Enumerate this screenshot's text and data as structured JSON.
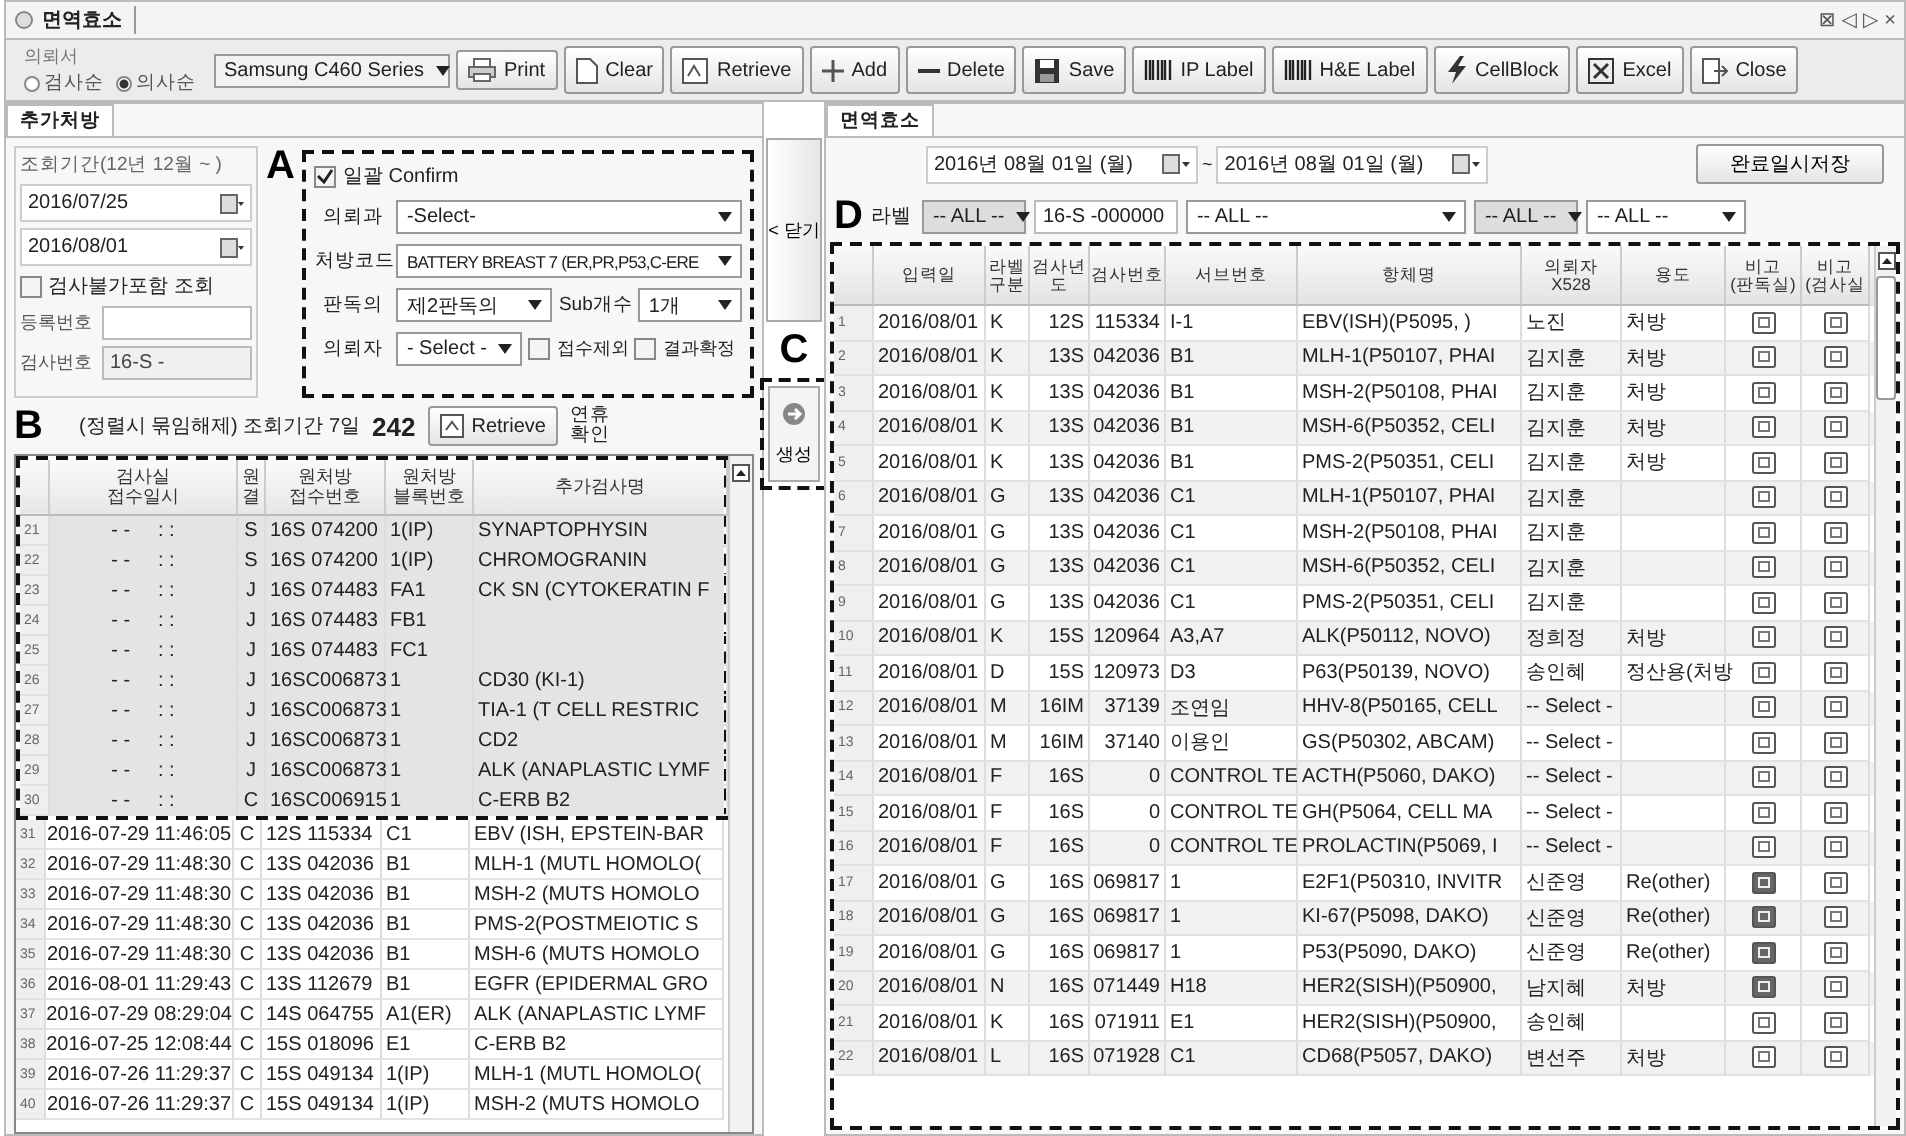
{
  "window": {
    "title": "면역효소",
    "controls": [
      "⊠",
      "◁",
      "▷",
      "×"
    ]
  },
  "callouts": [
    "A",
    "B",
    "C",
    "D"
  ],
  "toolbar": {
    "group_label": "의뢰서",
    "sort_options": [
      {
        "label": "검사순",
        "selected": false
      },
      {
        "label": "의사순",
        "selected": true
      }
    ],
    "printer": "Samsung C460 Series",
    "print_button": "Print",
    "buttons": [
      {
        "label": "Clear",
        "kind": "page"
      },
      {
        "label": "Retrieve",
        "kind": "retrieve"
      },
      {
        "label": "Add",
        "kind": "plus"
      },
      {
        "label": "Delete",
        "kind": "minus"
      },
      {
        "label": "Save",
        "kind": "disk"
      },
      {
        "label": "IP Label",
        "kind": "barcode"
      },
      {
        "label": "H&E Label",
        "kind": "barcode"
      },
      {
        "label": "CellBlock",
        "kind": "bolt"
      },
      {
        "label": "Excel",
        "kind": "grid"
      },
      {
        "label": "Close",
        "kind": "exit"
      }
    ]
  },
  "left": {
    "tab": "추가처방",
    "period": {
      "legend": "조회기간(12년 12월 ~ )",
      "from": "2016/07/25",
      "to": "2016/08/01"
    },
    "include_unavailable": {
      "label": "검사불가포함 조회",
      "checked": false
    },
    "reg_no": {
      "label": "등록번호"
    },
    "test_no": {
      "label": "검사번호",
      "value": "16-S -"
    },
    "batch": {
      "confirm": {
        "label": "일괄 Confirm",
        "checked": true
      },
      "dept": {
        "label": "의뢰과",
        "value": "-Select-"
      },
      "order_code": {
        "label": "처방코드",
        "value": "BATTERY BREAST 7 (ER,PR,P53,C-ERE"
      },
      "reader": {
        "label": "판독의",
        "value": "제2판독의"
      },
      "sub_count": {
        "label": "Sub개수",
        "value": "1개"
      },
      "requester": {
        "label": "의뢰자",
        "value": "- Select -"
      },
      "flags": [
        {
          "label": "접수제외",
          "checked": false
        },
        {
          "label": "결과확정",
          "checked": false
        }
      ]
    },
    "summary": {
      "note": "(정렬시 묶임해제) 조회기간 7일",
      "count": "242",
      "retrieve": "Retrieve",
      "holiday": "연휴\n확인"
    },
    "table": {
      "columns": [
        "검사실\n접수일시",
        "원결",
        "원처방\n접수번호",
        "원처방\n블록번호",
        "추가검사명"
      ],
      "rows": [
        {
          "no": "21",
          "time": "- -     : :",
          "code": "S",
          "receipt": "16S 074200",
          "block": "1(IP)",
          "test": "SYNAPTOPHYSIN",
          "shaded": true
        },
        {
          "no": "22",
          "time": "- -     : :",
          "code": "S",
          "receipt": "16S 074200",
          "block": "1(IP)",
          "test": "CHROMOGRANIN",
          "shaded": true
        },
        {
          "no": "23",
          "time": "- -     : :",
          "code": "J",
          "receipt": "16S 074483",
          "block": "FA1",
          "test": "CK SN (CYTOKERATIN F",
          "shaded": true
        },
        {
          "no": "24",
          "time": "- -     : :",
          "code": "J",
          "receipt": "16S 074483",
          "block": "FB1",
          "shaded": true
        },
        {
          "no": "25",
          "time": "- -     : :",
          "code": "J",
          "receipt": "16S 074483",
          "block": "FC1",
          "shaded": true
        },
        {
          "no": "26",
          "time": "- -     : :",
          "code": "J",
          "receipt": "16SC006873",
          "block": "1",
          "test": "CD30 (KI-1)",
          "shaded": true
        },
        {
          "no": "27",
          "time": "- -     : :",
          "code": "J",
          "receipt": "16SC006873",
          "block": "1",
          "test": "TIA-1 (T CELL RESTRIC",
          "shaded": true
        },
        {
          "no": "28",
          "time": "- -     : :",
          "code": "J",
          "receipt": "16SC006873",
          "block": "1",
          "test": "CD2",
          "shaded": true
        },
        {
          "no": "29",
          "time": "- -     : :",
          "code": "J",
          "receipt": "16SC006873",
          "block": "1",
          "test": "ALK (ANAPLASTIC LYMF",
          "shaded": true
        },
        {
          "no": "30",
          "time": "- -     : :",
          "code": "C",
          "receipt": "16SC006915",
          "block": "1",
          "test": "C-ERB B2",
          "shaded": true
        },
        {
          "no": "31",
          "time": "2016-07-29 11:46:05",
          "code": "C",
          "receipt": "12S 115334",
          "block": "C1",
          "test": "EBV (ISH, EPSTEIN-BAR",
          "shaded": false
        },
        {
          "no": "32",
          "time": "2016-07-29 11:48:30",
          "code": "C",
          "receipt": "13S 042036",
          "block": "B1",
          "test": "MLH-1 (MUTL HOMOLO(",
          "shaded": false
        },
        {
          "no": "33",
          "time": "2016-07-29 11:48:30",
          "code": "C",
          "receipt": "13S 042036",
          "block": "B1",
          "test": "MSH-2 (MUTS HOMOLO",
          "shaded": false
        },
        {
          "no": "34",
          "time": "2016-07-29 11:48:30",
          "code": "C",
          "receipt": "13S 042036",
          "block": "B1",
          "test": "PMS-2(POSTMEIOTIC S",
          "shaded": false
        },
        {
          "no": "35",
          "time": "2016-07-29 11:48:30",
          "code": "C",
          "receipt": "13S 042036",
          "block": "B1",
          "test": "MSH-6 (MUTS HOMOLO",
          "shaded": false
        },
        {
          "no": "36",
          "time": "2016-08-01 11:29:43",
          "code": "C",
          "receipt": "13S 112679",
          "block": "B1",
          "test": "EGFR (EPIDERMAL GRO",
          "shaded": false
        },
        {
          "no": "37",
          "time": "2016-07-29 08:29:04",
          "code": "C",
          "receipt": "14S 064755",
          "block": "A1(ER)",
          "test": "ALK (ANAPLASTIC LYMF",
          "shaded": false
        },
        {
          "no": "38",
          "time": "2016-07-25 12:08:44",
          "code": "C",
          "receipt": "15S 018096",
          "block": "E1",
          "test": "C-ERB B2",
          "shaded": false
        },
        {
          "no": "39",
          "time": "2016-07-26 11:29:37",
          "code": "C",
          "receipt": "15S 049134",
          "block": "1(IP)",
          "test": "MLH-1 (MUTL HOMOLO(",
          "shaded": false
        },
        {
          "no": "40",
          "time": "2016-07-26 11:29:37",
          "code": "C",
          "receipt": "15S 049134",
          "block": "1(IP)",
          "test": "MSH-2 (MUTS HOMOLO",
          "shaded": false
        }
      ]
    }
  },
  "middle": {
    "close": "< 닫기",
    "generate": "생성"
  },
  "right": {
    "tab": "면역효소",
    "from": "2016년 08월 01일 (월)",
    "range_sep": "~",
    "to": "2016년 08월 01일 (월)",
    "save_button": "완료일시저장",
    "filter_label": "라벨",
    "label_filter": "-- ALL --",
    "number": "16-S -000000",
    "filters": [
      "-- ALL --",
      "-- ALL --",
      "-- ALL --"
    ],
    "table": {
      "columns": [
        "입력일",
        "라벨\n구분",
        "검사년도",
        "검사번호",
        "서브번호",
        "항체명",
        "의뢰자\nX528",
        "용도",
        "비고\n(판독실)",
        "비고\n(검사실"
      ],
      "rows": [
        {
          "no": "1",
          "date": "2016/08/01",
          "label": "K",
          "year": "12S",
          "num": "115334",
          "sub": "I-1",
          "antibody": "EBV(ISH)(P5095, )",
          "requester": "노진",
          "purpose": "처방",
          "note_filled": false
        },
        {
          "no": "2",
          "date": "2016/08/01",
          "label": "K",
          "year": "13S",
          "num": "042036",
          "sub": "B1",
          "antibody": "MLH-1(P50107, PHAI",
          "requester": "김지훈",
          "purpose": "처방",
          "note_filled": false
        },
        {
          "no": "3",
          "date": "2016/08/01",
          "label": "K",
          "year": "13S",
          "num": "042036",
          "sub": "B1",
          "antibody": "MSH-2(P50108, PHAI",
          "requester": "김지훈",
          "purpose": "처방",
          "note_filled": false
        },
        {
          "no": "4",
          "date": "2016/08/01",
          "label": "K",
          "year": "13S",
          "num": "042036",
          "sub": "B1",
          "antibody": "MSH-6(P50352, CELI",
          "requester": "김지훈",
          "purpose": "처방",
          "note_filled": false
        },
        {
          "no": "5",
          "date": "2016/08/01",
          "label": "K",
          "year": "13S",
          "num": "042036",
          "sub": "B1",
          "antibody": "PMS-2(P50351, CELI",
          "requester": "김지훈",
          "purpose": "처방",
          "note_filled": false
        },
        {
          "no": "6",
          "date": "2016/08/01",
          "label": "G",
          "year": "13S",
          "num": "042036",
          "sub": "C1",
          "antibody": "MLH-1(P50107, PHAI",
          "requester": "김지훈",
          "note_filled": false
        },
        {
          "no": "7",
          "date": "2016/08/01",
          "label": "G",
          "year": "13S",
          "num": "042036",
          "sub": "C1",
          "antibody": "MSH-2(P50108, PHAI",
          "requester": "김지훈",
          "note_filled": false
        },
        {
          "no": "8",
          "date": "2016/08/01",
          "label": "G",
          "year": "13S",
          "num": "042036",
          "sub": "C1",
          "antibody": "MSH-6(P50352, CELI",
          "requester": "김지훈",
          "note_filled": false
        },
        {
          "no": "9",
          "date": "2016/08/01",
          "label": "G",
          "year": "13S",
          "num": "042036",
          "sub": "C1",
          "antibody": "PMS-2(P50351, CELI",
          "requester": "김지훈",
          "note_filled": false
        },
        {
          "no": "10",
          "date": "2016/08/01",
          "label": "K",
          "year": "15S",
          "num": "120964",
          "sub": "A3,A7",
          "antibody": "ALK(P50112, NOVO)",
          "requester": "정희정",
          "purpose": "처방",
          "note_filled": false
        },
        {
          "no": "11",
          "date": "2016/08/01",
          "label": "D",
          "year": "15S",
          "num": "120973",
          "sub": "D3",
          "antibody": "P63(P50139, NOVO)",
          "requester": "송인혜",
          "purpose": "정산용(처방",
          "note_filled": false
        },
        {
          "no": "12",
          "date": "2016/08/01",
          "label": "M",
          "year": "16IM",
          "num": "37139",
          "sub": "조연임",
          "antibody": "HHV-8(P50165, CELL",
          "requester": "-- Select -",
          "note_filled": false
        },
        {
          "no": "13",
          "date": "2016/08/01",
          "label": "M",
          "year": "16IM",
          "num": "37140",
          "sub": "이용인",
          "antibody": "GS(P50302, ABCAM)",
          "requester": "-- Select -",
          "note_filled": false
        },
        {
          "no": "14",
          "date": "2016/08/01",
          "label": "F",
          "year": "16S",
          "num": "0",
          "sub": "CONTROL TE",
          "antibody": "ACTH(P5060, DAKO)",
          "requester": "-- Select -",
          "note_filled": false
        },
        {
          "no": "15",
          "date": "2016/08/01",
          "label": "F",
          "year": "16S",
          "num": "0",
          "sub": "CONTROL TE",
          "antibody": "GH(P5064, CELL MA",
          "requester": "-- Select -",
          "note_filled": false
        },
        {
          "no": "16",
          "date": "2016/08/01",
          "label": "F",
          "year": "16S",
          "num": "0",
          "sub": "CONTROL TE",
          "antibody": "PROLACTIN(P5069, I",
          "requester": "-- Select -",
          "note_filled": false
        },
        {
          "no": "17",
          "date": "2016/08/01",
          "label": "G",
          "year": "16S",
          "num": "069817",
          "sub": "1",
          "antibody": "E2F1(P50310, INVITR",
          "requester": "신준영",
          "purpose": "Re(other)",
          "note_filled": true
        },
        {
          "no": "18",
          "date": "2016/08/01",
          "label": "G",
          "year": "16S",
          "num": "069817",
          "sub": "1",
          "antibody": "KI-67(P5098, DAKO)",
          "requester": "신준영",
          "purpose": "Re(other)",
          "note_filled": true
        },
        {
          "no": "19",
          "date": "2016/08/01",
          "label": "G",
          "year": "16S",
          "num": "069817",
          "sub": "1",
          "antibody": "P53(P5090, DAKO)",
          "requester": "신준영",
          "purpose": "Re(other)",
          "note_filled": true
        },
        {
          "no": "20",
          "date": "2016/08/01",
          "label": "N",
          "year": "16S",
          "num": "071449",
          "sub": "H18",
          "antibody": "HER2(SISH)(P50900,",
          "requester": "남지혜",
          "purpose": "처방",
          "note_filled": true
        },
        {
          "no": "21",
          "date": "2016/08/01",
          "label": "K",
          "year": "16S",
          "num": "071911",
          "sub": "E1",
          "antibody": "HER2(SISH)(P50900,",
          "requester": "송인혜",
          "note_filled": false
        },
        {
          "no": "22",
          "date": "2016/08/01",
          "label": "L",
          "year": "16S",
          "num": "071928",
          "sub": "C1",
          "antibody": "CD68(P5057, DAKO)",
          "requester": "변선주",
          "purpose": "처방",
          "note_filled": false
        }
      ]
    }
  }
}
